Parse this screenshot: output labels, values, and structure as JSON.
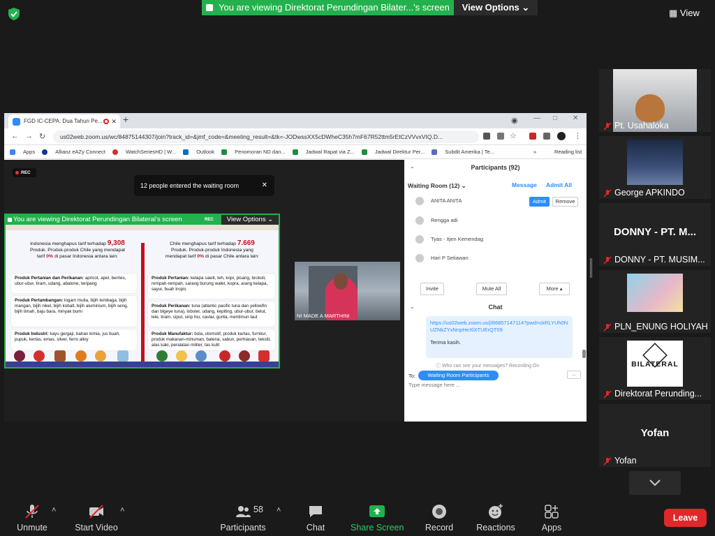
{
  "top": {
    "share_banner": "You are viewing Direktorat Perundingan Bilater...'s screen",
    "view_options": "View Options",
    "view": "View"
  },
  "browser": {
    "tab_title": "FGD IC-CEPA: Dua Tahun Pe...",
    "url": "us02web.zoom.us/wc/84875144307/join?track_id=&jmf_code=&meeting_result=&tk=-JODwssXX5cDWheC35h7mF67R52ttm5rEtCzVVvxVIQ.D...",
    "bookmarks": [
      "Apps",
      "Allianz eAZy Connect",
      "WatchSeriesHD | W...",
      "Outlook",
      "Penomoran ND dan...",
      "Jadwal Rapat via Z...",
      "Jadwal Direktur Per...",
      "Subdit Amerika | Te..."
    ],
    "reading_list": "Reading list"
  },
  "zoomweb": {
    "rec": "REC",
    "waiting_toast": "12 people entered the waiting room",
    "inner_banner": "You are viewing Direktorat Perundingan Bilateral's screen",
    "inner_view_options": "View Options",
    "inner_rec": "REC",
    "speaker_name": "NI MADE A MARTHINI"
  },
  "slide": {
    "left_intro_1": "Indonesia menghapus  tarif terhadap",
    "left_number": "9,308",
    "left_intro_2": "Produk. Produk-produk Chile yang mendapat",
    "left_intro_3_pre": "tarif",
    "left_intro_3_rate": "0%",
    "left_intro_3_post": "di pasar Indonesia antara lain:",
    "right_intro_1": "Chile menghapus  tarif terhadap",
    "right_number": "7.669",
    "right_intro_2": "Produk. Produk-produk Indonesia yang",
    "right_intro_3_pre": "mendapat tarif",
    "right_intro_3_rate": "0%",
    "right_intro_3_post": "di pasar Chile antara lain:",
    "cards_left": [
      {
        "title": "Produk Pertanian dan Perikanan:",
        "text": "apricot, apel, berries, ubur-ubur, tiram, udang, abalone, teripang"
      },
      {
        "title": "Produk Pertambangan:",
        "text": "logam mulia, bijih tembaga, bijih mangan, bijih nikel, bijih kobalt, bijih aluminium, bijih seng, bijih timah, baju bara, minyak bumi"
      },
      {
        "title": "Produk Industri:",
        "text": "kayu gergaji, bahan kimia, jus buah, pupuk, kertas, emas, silver, ferro alloy"
      }
    ],
    "cards_right": [
      {
        "title": "Produk Pertanian:",
        "text": "kelapa sawit, teh, kopi, pisang, brokoli, rempah-rempah, sarang burung walet, kopra, arang kelapa, sayur, buah tropis"
      },
      {
        "title": "Produk Perikanan:",
        "text": "tuna (atlantic pacific tuna dan yellowfin dan bigeye tuna), lobster, udang, kepiting, ubur-ubur, belut, lele, tiram, siput, sirip hiu, cavlar, gurita, mentimun laut"
      },
      {
        "title": "Produk Manufaktur:",
        "text": "bola, otomotif, produk kertas, furnitur, produk makanan-minuman, baterai, sabun, perhiasan, tekstil, alas kaki, peralatan militer, tas kulit"
      }
    ]
  },
  "participants": {
    "header": "Participants (92)",
    "waiting_room": "Waiting Room (12)",
    "message": "Message",
    "admit_all": "Admit All",
    "admit": "Admit",
    "remove": "Remove",
    "waiting": [
      "ANITA ANITA",
      "Rengga adi",
      "Tyas - Itjen Kemendag",
      "Hari P Setiawan"
    ],
    "invite": "Invite",
    "mute_all": "Mute All",
    "more": "More"
  },
  "chat": {
    "header": "Chat",
    "link": "https://us02web.zoom.us/j/86857147114?pwd=ckRLYUh0NUZNkZYxNnpHeXlXTUErQT09",
    "message": "Terima kasih.",
    "who_see": "Who can see your messages? Recording On",
    "to_label": "To:",
    "to_value": "Waiting Room Participants",
    "more": "...",
    "placeholder": "Type message here ..."
  },
  "gallery": [
    {
      "name": "Pt. Usahaloka",
      "kind": "video"
    },
    {
      "name": "George APKINDO",
      "kind": "video"
    },
    {
      "name": "DONNY - PT. MUSIM...",
      "big": "DONNY  -  PT. M...",
      "kind": "text"
    },
    {
      "name": "PLN_ENUNG HOLIYAH",
      "kind": "video"
    },
    {
      "name": "Direktorat Perunding...",
      "logo": "BILATERAL",
      "kind": "logo"
    },
    {
      "name": "Yofan",
      "big": "Yofan",
      "kind": "text"
    }
  ],
  "toolbar": {
    "unmute": "Unmute",
    "start_video": "Start Video",
    "participants": "Participants",
    "participants_count": "58",
    "chat": "Chat",
    "share_screen": "Share Screen",
    "record": "Record",
    "reactions": "Reactions",
    "apps": "Apps",
    "leave": "Leave"
  },
  "colors": {
    "accent_green": "#23b14d",
    "accent_blue": "#2d8cff",
    "leave_red": "#e02828",
    "slide_red": "#c1121f"
  }
}
